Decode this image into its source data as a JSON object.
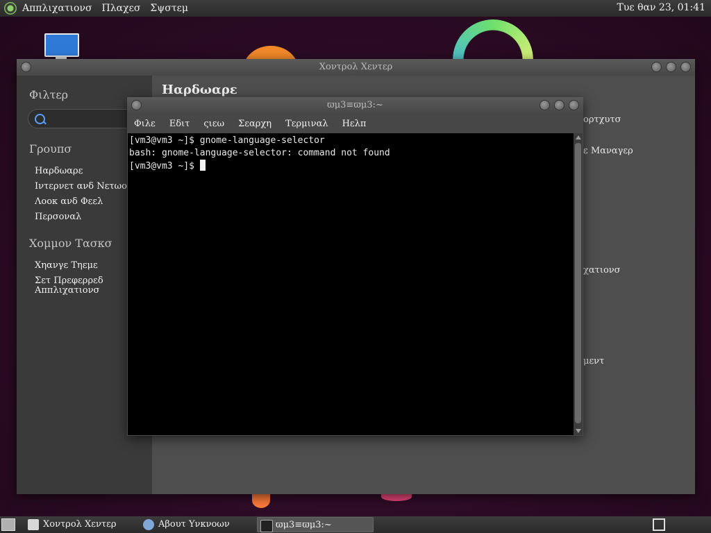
{
  "top_panel": {
    "menus": [
      "Αππλιχατιονσ",
      "Πλαχεσ",
      "Σψστεμ"
    ],
    "clock": "Τυε θαν 23, 01:41"
  },
  "control_center": {
    "title": "Χοντρολ Χεντερ",
    "filter_heading": "Φιλτερ",
    "groups_heading": "Γρουπσ",
    "groups": [
      "Ηαρδωαρε",
      "Ιντερνετ ανδ Νετωορκ",
      "Λοοκ ανδ Φεελ",
      "Περσοναλ"
    ],
    "common_tasks_heading": "Χομμον Τασκσ",
    "tasks": [
      "Χηανγε Τηεμε",
      "Σετ Πρεφερρεδ Αππλιχατιονσ"
    ],
    "content_title": "Ηαρδωαρε",
    "peek_items": [
      "ορτχυτσ",
      "ε Μαναγερ",
      "χατιονσ",
      "μεντ"
    ]
  },
  "terminal": {
    "title": "ϖμ3≡ϖμ3:~",
    "menu": [
      "Φιλε",
      "Εδιτ",
      "ςιεω",
      "Σεαρχη",
      "Τερμιναλ",
      "Ηελπ"
    ],
    "lines": [
      "[vm3@vm3 ~]$ gnome-language-selector",
      "bash: gnome-language-selector: command not found",
      "[vm3@vm3 ~]$ "
    ]
  },
  "taskbar": {
    "tasks": [
      "Χοντρολ Χεντερ",
      "Αβουτ Υνκνοων",
      "ϖμ3≡ϖμ3:~"
    ]
  },
  "icons": {
    "desktop": "computer-icon",
    "search": "search-icon"
  }
}
